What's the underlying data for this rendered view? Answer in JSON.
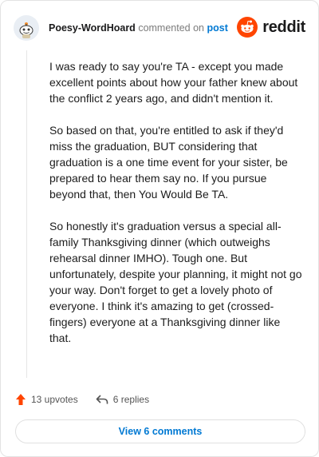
{
  "header": {
    "username": "Poesy-WordHoard",
    "action": "commented on",
    "post_link": "post",
    "brand": "reddit"
  },
  "comment": {
    "paragraphs": [
      "I was ready to say you're TA - except you made excellent points about how your father knew about the conflict 2 years ago, and didn't mention it.",
      "So based on that, you're entitled to ask if they'd miss the graduation, BUT considering that graduation is a one time event for your sister, be prepared to hear them say no. If you pursue beyond that, then You Would Be TA.",
      "So honestly it's graduation versus a special all-family Thanksgiving dinner (which outweighs rehearsal dinner IMHO). Tough one. But unfortunately, despite your planning, it might not go your way. Don't forget to get a lovely photo of everyone. I think it's amazing to get (crossed-fingers) everyone at a Thanksgiving dinner like that."
    ]
  },
  "footer": {
    "upvotes": "13 upvotes",
    "replies": "6 replies",
    "view_comments": "View 6 comments"
  },
  "colors": {
    "upvote": "#ff4500",
    "link": "#0079d3",
    "brand": "#ff4500"
  },
  "icons": {
    "avatar": "snoo-avatar-icon",
    "brand": "reddit-logo-icon",
    "upvote": "upvote-arrow-icon",
    "reply": "reply-arrow-icon"
  }
}
